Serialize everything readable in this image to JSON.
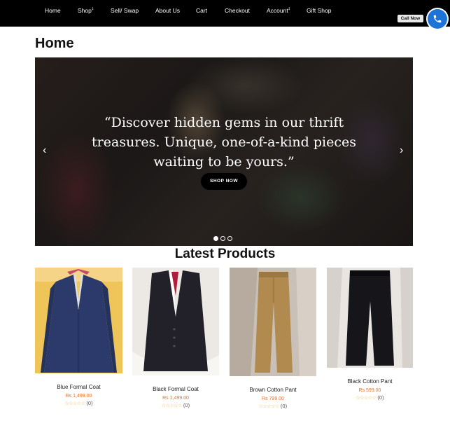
{
  "nav": {
    "items": [
      {
        "label": "Home",
        "caret": ""
      },
      {
        "label": "Shop",
        "caret": "‡"
      },
      {
        "label": "Sell/ Swap",
        "caret": ""
      },
      {
        "label": "About Us",
        "caret": ""
      },
      {
        "label": "Cart",
        "caret": ""
      },
      {
        "label": "Checkout",
        "caret": ""
      },
      {
        "label": "Account",
        "caret": "‡"
      },
      {
        "label": "Gift Shop",
        "caret": ""
      }
    ],
    "call_label": "Call Now"
  },
  "page": {
    "title": "Home"
  },
  "hero": {
    "quote": "“Discover hidden gems in our thrift treasures. Unique, one-of-a-kind pieces waiting to be yours.”",
    "button": "SHOP NOW",
    "prev_icon": "‹",
    "next_icon": "›",
    "slide_count": 3,
    "active_slide": 1
  },
  "latest": {
    "title": "Latest Products",
    "products": [
      {
        "name": "Blue Formal Coat",
        "price": "Rs 1,499.00",
        "stars": "☆☆☆☆☆",
        "reviews": "(0)",
        "image": "blue-coat"
      },
      {
        "name": "Black Formal Coat",
        "price": "Rs 1,499.00",
        "stars": "☆☆☆☆☆",
        "reviews": "(0)",
        "image": "black-coat"
      },
      {
        "name": "Brown Cotton Pant",
        "price": "Rs 799.00",
        "stars": "☆☆☆☆☆",
        "reviews": "(0)",
        "image": "brown-pant"
      },
      {
        "name": "Black Cotton Pant",
        "price": "Rs 599.00",
        "stars": "☆☆☆☆☆",
        "reviews": "(0)",
        "image": "black-pant"
      }
    ]
  },
  "colors": {
    "nav_bg": "#000000",
    "accent_price": "#e0712b",
    "call_button": "#1e73d6"
  }
}
